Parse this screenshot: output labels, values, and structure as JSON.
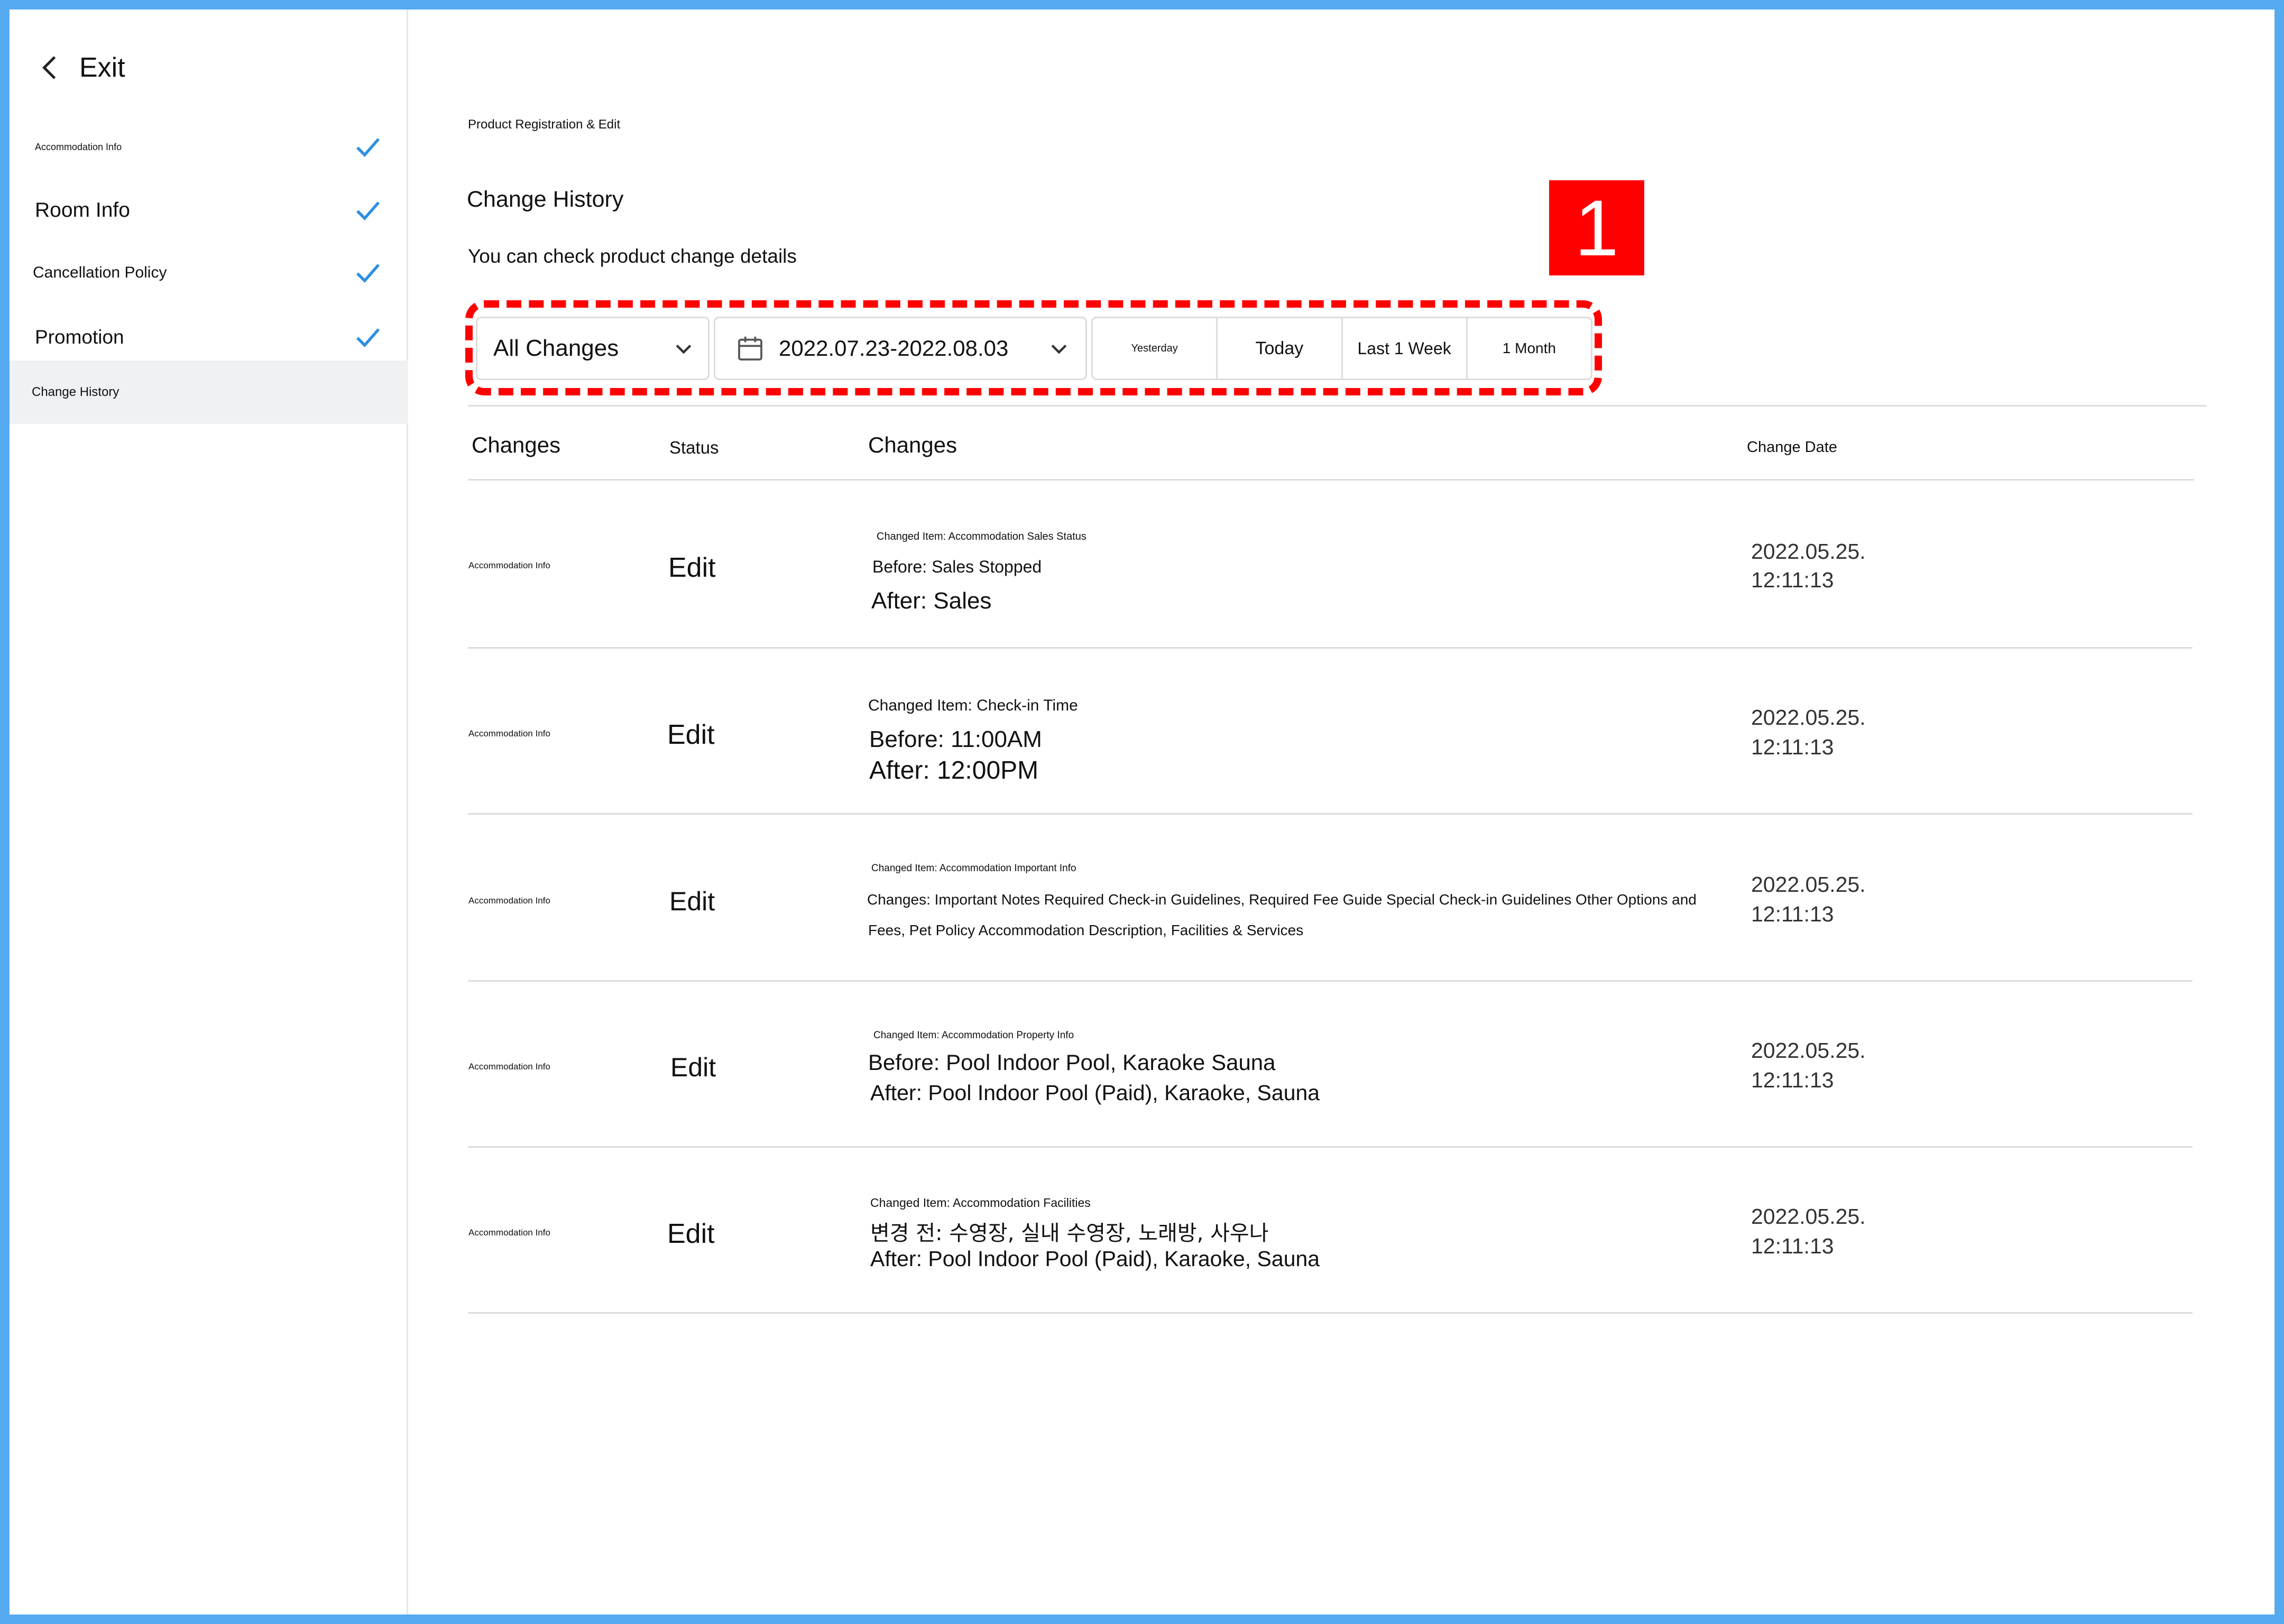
{
  "sidebar": {
    "exit_label": "Exit",
    "items": [
      {
        "label": "Accommodation Info",
        "checked": true
      },
      {
        "label": "Room Info",
        "checked": true
      },
      {
        "label": "Cancellation Policy",
        "checked": true
      },
      {
        "label": "Promotion",
        "checked": true
      },
      {
        "label": "Change History",
        "checked": false,
        "active": true
      }
    ]
  },
  "breadcrumb": "Product Registration & Edit",
  "page": {
    "title": "Change History",
    "description": "You can check product change details"
  },
  "annotation_badge": "1",
  "filters": {
    "change_type": "All Changes",
    "date_range": "2022.07.23-2022.08.03",
    "quick_ranges": [
      "Yesterday",
      "Today",
      "Last 1 Week",
      "1 Month"
    ]
  },
  "table": {
    "headers": [
      "Changes",
      "Status",
      "Changes",
      "Change Date"
    ],
    "rows": [
      {
        "category": "Accommodation Info",
        "status": "Edit",
        "item": "Changed Item: Accommodation Sales Status",
        "detail1": "Before: Sales Stopped",
        "detail2": "After: Sales",
        "date": "2022.05.25.",
        "time": "12:11:13"
      },
      {
        "category": "Accommodation Info",
        "status": "Edit",
        "item": "Changed Item: Check-in Time",
        "detail1": "Before: 11:00AM",
        "detail2": "After: 12:00PM",
        "date": "2022.05.25.",
        "time": "12:11:13"
      },
      {
        "category": "Accommodation Info",
        "status": "Edit",
        "item": "Changed Item: Accommodation Important Info",
        "detail1": "Changes: Important Notes Required Check-in Guidelines, Required Fee Guide Special Check-in Guidelines Other Options and",
        "detail2": "Fees, Pet Policy Accommodation Description, Facilities & Services",
        "date": "2022.05.25.",
        "time": "12:11:13"
      },
      {
        "category": "Accommodation Info",
        "status": "Edit",
        "item": "Changed Item: Accommodation Property Info",
        "detail1": "Before: Pool Indoor Pool, Karaoke Sauna",
        "detail2": "After: Pool Indoor Pool (Paid), Karaoke, Sauna",
        "date": "2022.05.25.",
        "time": "12:11:13"
      },
      {
        "category": "Accommodation Info",
        "status": "Edit",
        "item": "Changed Item: Accommodation Facilities",
        "detail1": "변경 전: 수영장, 실내 수영장, 노래방, 사우나",
        "detail2": "After: Pool Indoor Pool (Paid), Karaoke, Sauna",
        "date": "2022.05.25.",
        "time": "12:11:13"
      }
    ]
  },
  "colors": {
    "frame_border": "#55aaf0",
    "check": "#2f8fe0",
    "annotation": "#ff0000",
    "active_item_bg": "#f0f1f2",
    "divider": "#dcdcdc"
  }
}
